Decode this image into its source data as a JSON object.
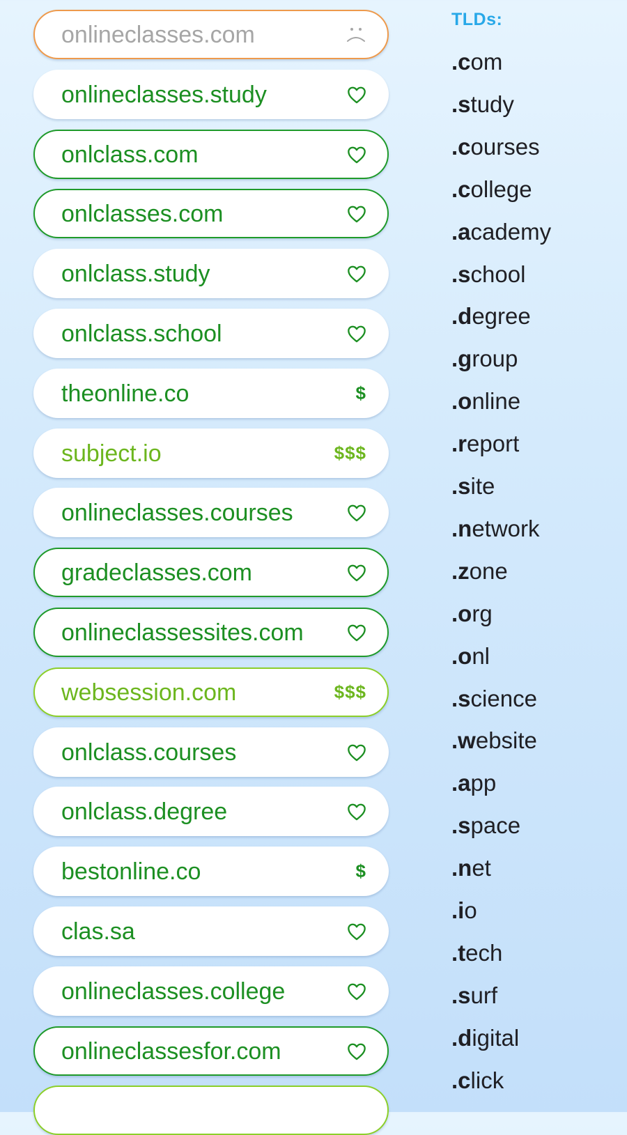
{
  "domains": [
    {
      "name": "onlineclasses.com",
      "tag": "frown-icon",
      "text": "gray",
      "outline": "orange"
    },
    {
      "name": "onlineclasses.study",
      "tag": "heart-icon",
      "text": "green",
      "outline": "none"
    },
    {
      "name": "onlclass.com",
      "tag": "heart-icon",
      "text": "green",
      "outline": "green"
    },
    {
      "name": "onlclasses.com",
      "tag": "heart-icon",
      "text": "green",
      "outline": "green"
    },
    {
      "name": "onlclass.study",
      "tag": "heart-icon",
      "text": "green",
      "outline": "none"
    },
    {
      "name": "onlclass.school",
      "tag": "heart-icon",
      "text": "green",
      "outline": "none"
    },
    {
      "name": "theonline.co",
      "tag": "$",
      "text": "green",
      "outline": "none"
    },
    {
      "name": "subject.io",
      "tag": "$$$",
      "text": "lime",
      "outline": "none"
    },
    {
      "name": "onlineclasses.courses",
      "tag": "heart-icon",
      "text": "green",
      "outline": "none"
    },
    {
      "name": "gradeclasses.com",
      "tag": "heart-icon",
      "text": "green",
      "outline": "green"
    },
    {
      "name": "onlineclassessites.com",
      "tag": "heart-icon",
      "text": "green",
      "outline": "green"
    },
    {
      "name": "websession.com",
      "tag": "$$$",
      "text": "lime",
      "outline": "lime"
    },
    {
      "name": "onlclass.courses",
      "tag": "heart-icon",
      "text": "green",
      "outline": "none"
    },
    {
      "name": "onlclass.degree",
      "tag": "heart-icon",
      "text": "green",
      "outline": "none"
    },
    {
      "name": "bestonline.co",
      "tag": "$",
      "text": "green",
      "outline": "none"
    },
    {
      "name": "clas.sa",
      "tag": "heart-icon",
      "text": "green",
      "outline": "none"
    },
    {
      "name": "onlineclasses.college",
      "tag": "heart-icon",
      "text": "green",
      "outline": "none"
    },
    {
      "name": "onlineclassesfor.com",
      "tag": "heart-icon",
      "text": "green",
      "outline": "green"
    },
    {
      "name": "",
      "tag": "",
      "text": "green",
      "outline": "lime"
    }
  ],
  "tld_panel": {
    "heading": "TLDs:",
    "items": [
      ".com",
      ".study",
      ".courses",
      ".college",
      ".academy",
      ".school",
      ".degree",
      ".group",
      ".online",
      ".report",
      ".site",
      ".network",
      ".zone",
      ".org",
      ".onl",
      ".science",
      ".website",
      ".app",
      ".space",
      ".net",
      ".io",
      ".tech",
      ".surf",
      ".digital",
      ".click"
    ]
  },
  "colors": {
    "accent_blue": "#28a8e8",
    "available_green": "#1c8f22",
    "premium_lime": "#6cb61e",
    "taken_gray": "#a6a6a6",
    "taken_outline": "#ee9a4c"
  }
}
